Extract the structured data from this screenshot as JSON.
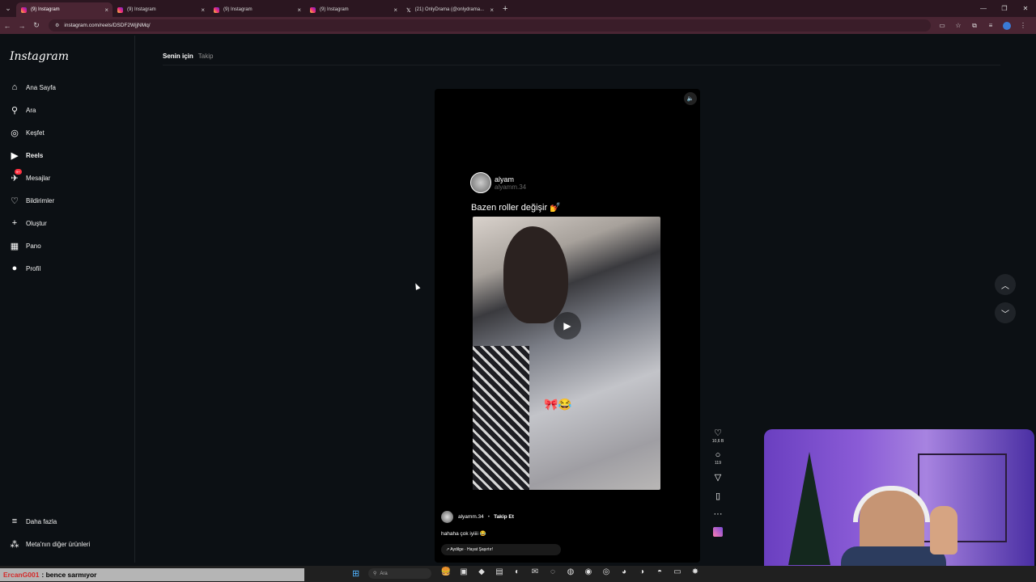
{
  "browser": {
    "tabs": [
      {
        "title": "(9) Instagram",
        "active": true
      },
      {
        "title": "(9) Instagram",
        "active": false
      },
      {
        "title": "(9) Instagram",
        "active": false
      },
      {
        "title": "(9) Instagram",
        "active": false
      },
      {
        "title": "(21) OnlyDrama (@onlydrama...",
        "active": false
      }
    ],
    "url": "instagram.com/reels/DSDF2WjjNMq/"
  },
  "sidebar": {
    "logo": "Instagram",
    "items": [
      {
        "label": "Ana Sayfa",
        "icon": "home-icon"
      },
      {
        "label": "Ara",
        "icon": "search-icon"
      },
      {
        "label": "Keşfet",
        "icon": "compass-icon"
      },
      {
        "label": "Reels",
        "icon": "reels-icon"
      },
      {
        "label": "Mesajlar",
        "icon": "messenger-icon",
        "badge": "9+"
      },
      {
        "label": "Bildirimler",
        "icon": "heart-icon"
      },
      {
        "label": "Oluştur",
        "icon": "plus-icon"
      },
      {
        "label": "Pano",
        "icon": "dashboard-icon"
      },
      {
        "label": "Profil",
        "icon": "avatar-icon"
      }
    ],
    "more": "Daha fazla",
    "meta": "Meta'nın diğer ürünleri"
  },
  "feed": {
    "tab_active": "Senin için",
    "tab_other": "Takip"
  },
  "reel": {
    "poster_name": "alyam",
    "poster_handle": "alyamm.34",
    "title": "Bazen roller değişir 💅",
    "author": "alyamm.34",
    "follow": "Takip Et",
    "caption": "hahaha çok iyiiii 😂",
    "audio": "↗ Aydilge · Hayat Şaşırtır!",
    "likes": "10,6 B",
    "comments": "119"
  },
  "overlay": {
    "chat_user": "ErcanG001",
    "chat_msg": ": bence sarmıyor"
  },
  "taskbar": {
    "search": "Ara"
  }
}
